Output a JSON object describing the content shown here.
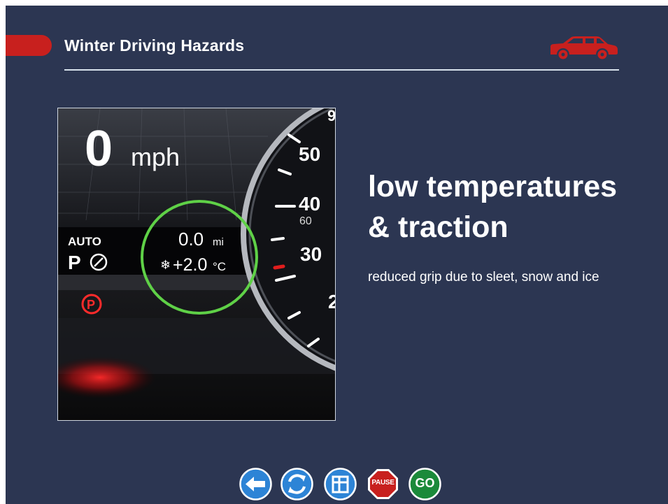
{
  "window": {
    "expand_glyph": "»"
  },
  "header": {
    "title": "Winter Driving Hazards",
    "accent_color": "#c8201e",
    "logo_icon": "car-icon"
  },
  "photo": {
    "speed_value": "0",
    "speed_unit": "mph",
    "auto_label": "AUTO",
    "park_label": "P",
    "odometer": "0.0",
    "odometer_unit": "mi",
    "temperature": "+2.0",
    "temperature_unit": "°C",
    "dial_numbers": [
      "50",
      "40",
      "60",
      "30"
    ],
    "dial_partial": [
      "9",
      "2"
    ],
    "highlight_color": "#5fd147",
    "park_brake_label": "P"
  },
  "content": {
    "headline_line1": "low temperatures",
    "headline_line2": "& traction",
    "subtext": "reduced grip due to sleet, snow and ice"
  },
  "nav": {
    "back_icon": "arrow-left-icon",
    "replay_icon": "replay-icon",
    "menu_icon": "menu-icon",
    "pause_label": "PAUSE",
    "go_label": "GO",
    "colors": {
      "blue": "#2d84d6",
      "red": "#c8201e",
      "green": "#1b8a3a"
    }
  }
}
